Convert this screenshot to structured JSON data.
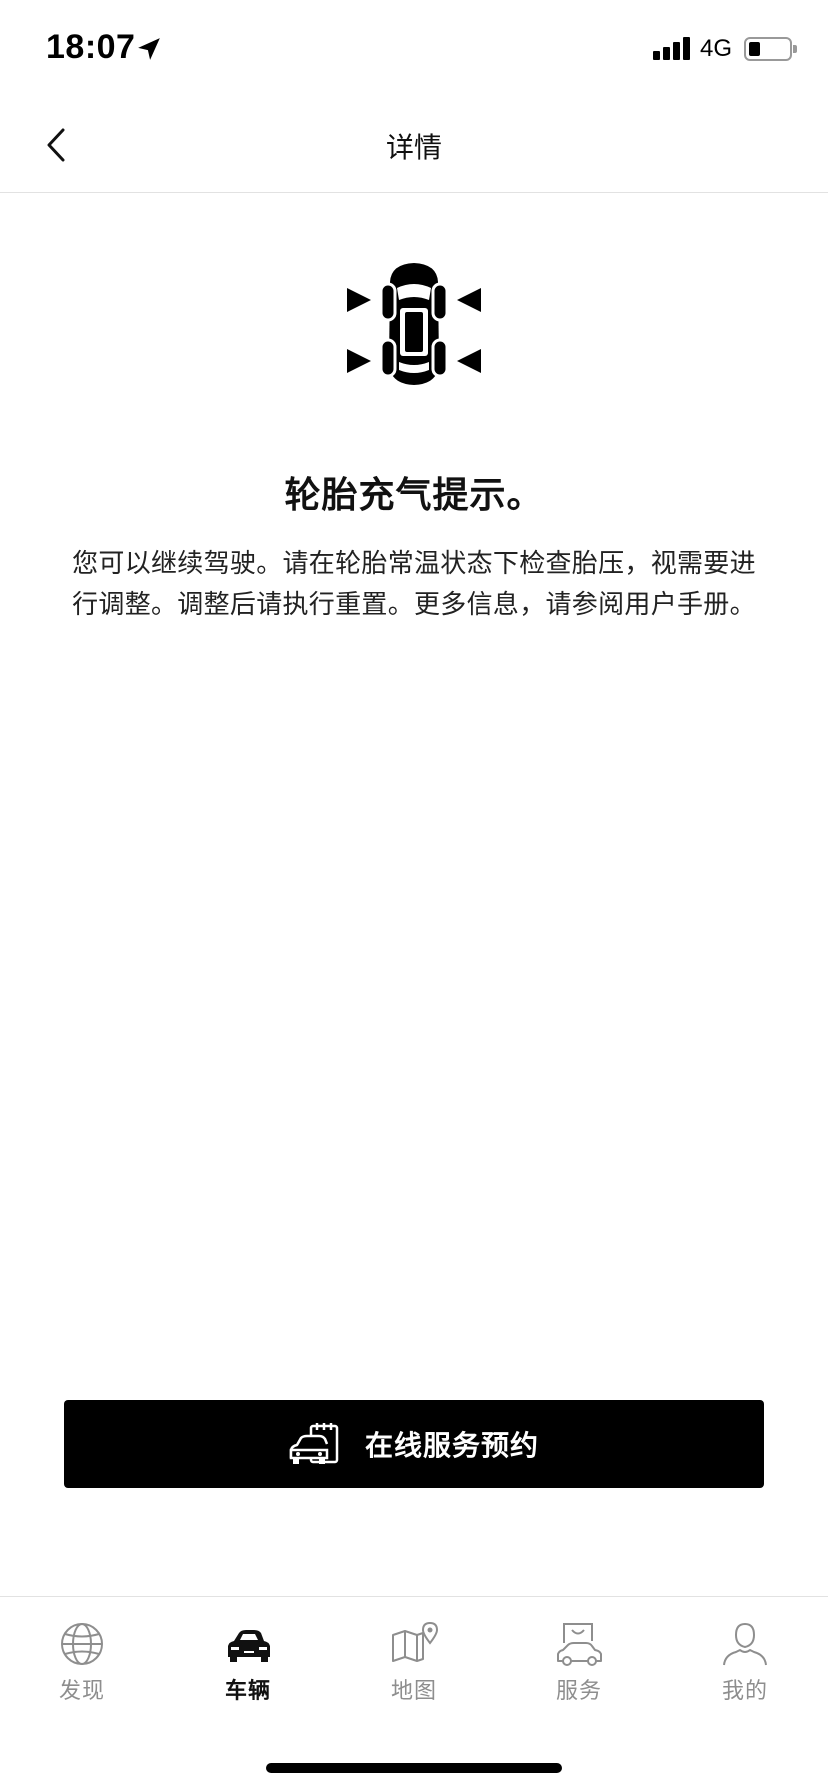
{
  "status_bar": {
    "time": "18:07",
    "network": "4G",
    "icons": [
      "location-arrow-icon",
      "signal-icon",
      "battery-icon"
    ]
  },
  "nav": {
    "title": "详情",
    "back_icon": "chevron-left-icon"
  },
  "alert": {
    "icon": "tire-pressure-car-icon",
    "title": "轮胎充气提示。",
    "body": "您可以继续驾驶。请在轮胎常温状态下检查胎压，视需要进行调整。调整后请执行重置。更多信息，请参阅用户手册。"
  },
  "cta": {
    "label": "在线服务预约",
    "icon": "service-booking-car-icon"
  },
  "tabs": [
    {
      "label": "发现",
      "icon": "globe-icon",
      "active": false
    },
    {
      "label": "车辆",
      "icon": "car-icon",
      "active": true
    },
    {
      "label": "地图",
      "icon": "map-pin-icon",
      "active": false
    },
    {
      "label": "服务",
      "icon": "shopping-bag-car-icon",
      "active": false
    },
    {
      "label": "我的",
      "icon": "person-icon",
      "active": false
    }
  ],
  "colors": {
    "primary": "#000000",
    "background": "#ffffff",
    "tab_inactive": "#8e8e8e",
    "divider": "#e2e2e2"
  }
}
